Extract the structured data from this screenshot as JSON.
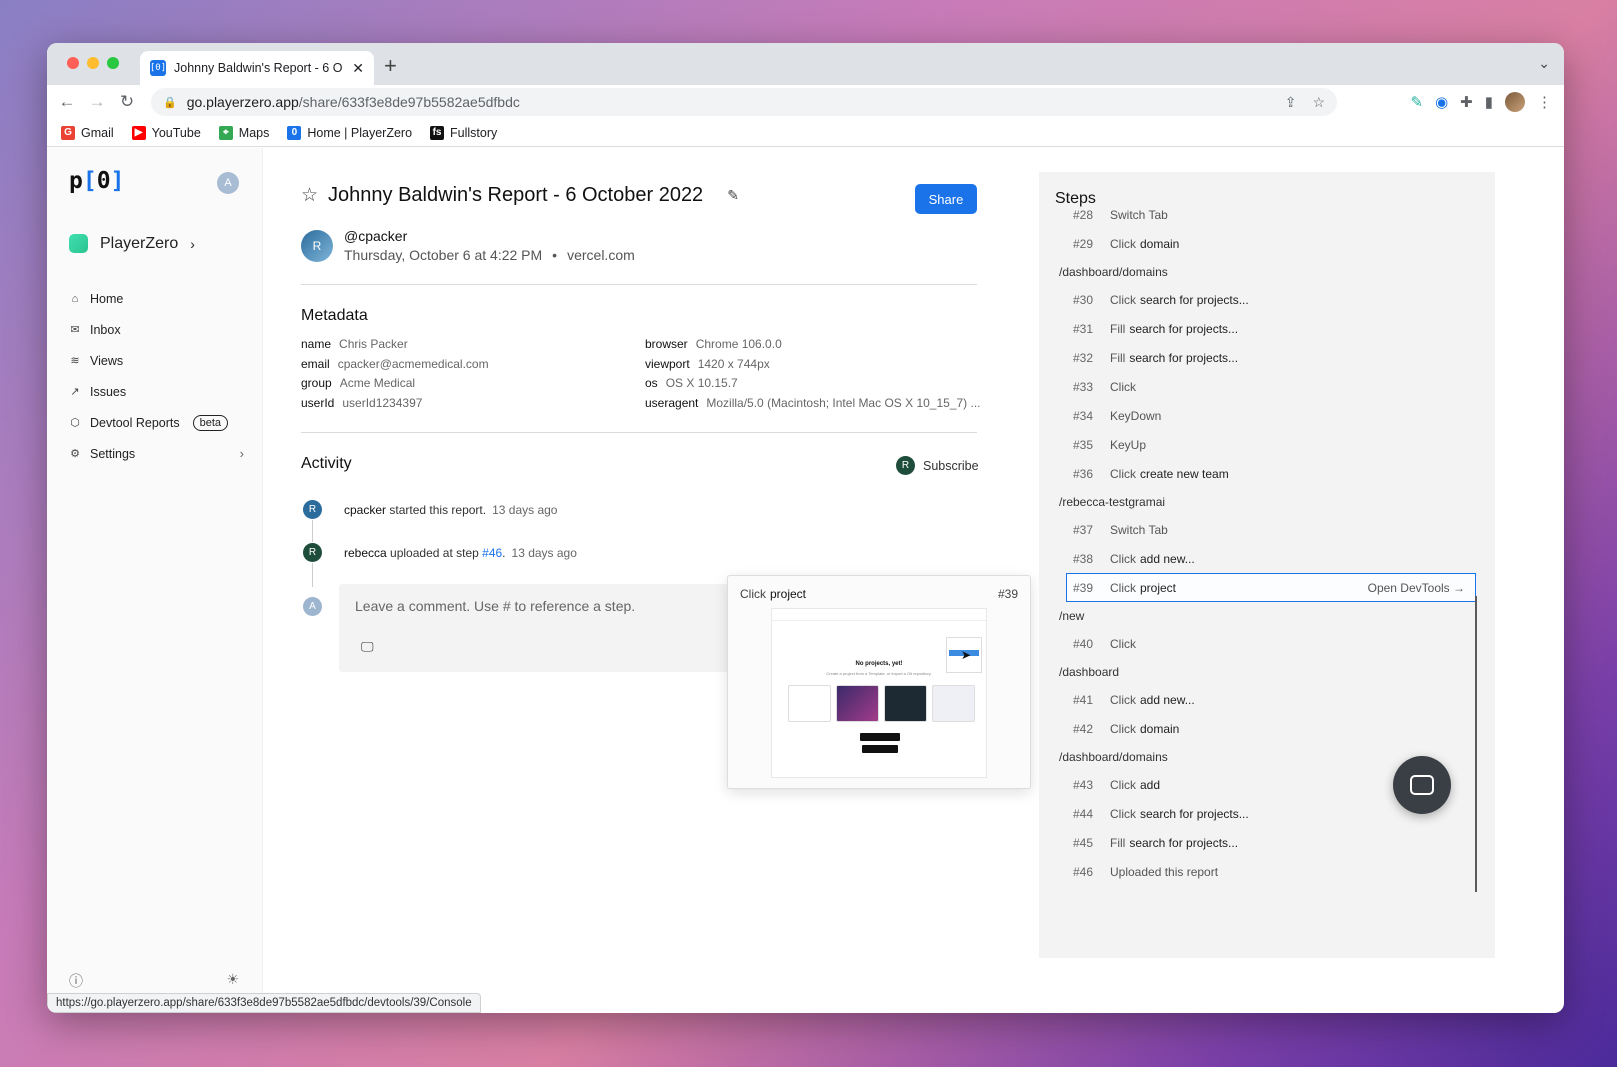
{
  "browser": {
    "tab_title": "Johnny Baldwin's Report - 6 O",
    "url_host": "go.playerzero.app",
    "url_path": "/share/633f3e8de97b5582ae5dfbdc",
    "favicon_text": "[0]",
    "bookmarks": [
      {
        "label": "Gmail",
        "icon": "gmail-icon",
        "color": "#ea4335"
      },
      {
        "label": "YouTube",
        "icon": "youtube-icon",
        "color": "#ff0000"
      },
      {
        "label": "Maps",
        "icon": "maps-icon",
        "color": "#34a853"
      },
      {
        "label": "Home | PlayerZero",
        "icon": "playerzero-icon",
        "color": "#1a73e8"
      },
      {
        "label": "Fullstory",
        "icon": "fullstory-icon",
        "color": "#111111"
      }
    ],
    "status_url": "https://go.playerzero.app/share/633f3e8de97b5582ae5dfbdc/devtools/39/Console"
  },
  "sidebar": {
    "logo_text": "p[0]",
    "user_initial": "A",
    "org_name": "PlayerZero",
    "nav": [
      {
        "label": "Home",
        "icon": "home-icon"
      },
      {
        "label": "Inbox",
        "icon": "inbox-icon"
      },
      {
        "label": "Views",
        "icon": "layers-icon"
      },
      {
        "label": "Issues",
        "icon": "arrow-up-right-icon"
      },
      {
        "label": "Devtool Reports",
        "icon": "cube-icon",
        "badge": "beta"
      },
      {
        "label": "Settings",
        "icon": "gear-icon"
      }
    ]
  },
  "report": {
    "title": "Johnny Baldwin's Report - 6 October 2022",
    "share_label": "Share",
    "author_initial": "R",
    "handle": "@cpacker",
    "datetime": "Thursday, October 6 at 4:22 PM",
    "domain": "vercel.com",
    "metadata_title": "Metadata",
    "metadata_left": [
      {
        "k": "name",
        "v": "Chris Packer"
      },
      {
        "k": "email",
        "v": "cpacker@acmemedical.com"
      },
      {
        "k": "group",
        "v": "Acme Medical"
      },
      {
        "k": "userId",
        "v": "userId1234397"
      }
    ],
    "metadata_right": [
      {
        "k": "browser",
        "v": "Chrome 106.0.0"
      },
      {
        "k": "viewport",
        "v": "1420 x 744px"
      },
      {
        "k": "os",
        "v": "OS X 10.15.7"
      },
      {
        "k": "useragent",
        "v": "Mozilla/5.0 (Macintosh; Intel Mac OS X 10_15_7) ..."
      }
    ],
    "activity_title": "Activity",
    "subscribe_label": "Subscribe",
    "subscribe_initial": "R",
    "activity": [
      {
        "initial": "R",
        "who": "cpacker",
        "text": "started this report.",
        "ref": "",
        "when": "13 days ago",
        "color": "#2b6c9c"
      },
      {
        "initial": "R",
        "who": "rebecca",
        "text": "uploaded at step",
        "ref": "#46",
        "when": "13 days ago",
        "color": "#1f4d3c"
      }
    ],
    "comment_initial": "A",
    "comment_placeholder": "Leave a comment. Use # to reference a step."
  },
  "preview": {
    "verb": "Click",
    "target": "project",
    "num": "#39",
    "thumb_title": "No projects, yet!",
    "thumb_subtitle": "Create a project from a Template, or import a Git repository."
  },
  "steps": {
    "title": "Steps",
    "open_devtools": "Open DevTools",
    "items": [
      {
        "type": "step",
        "n": "#28",
        "verb": "Switch Tab",
        "tgt": ""
      },
      {
        "type": "step",
        "n": "#29",
        "verb": "Click",
        "tgt": "domain"
      },
      {
        "type": "route",
        "path": "/dashboard/domains"
      },
      {
        "type": "step",
        "n": "#30",
        "verb": "Click",
        "tgt": "search for projects..."
      },
      {
        "type": "step",
        "n": "#31",
        "verb": "Fill",
        "tgt": "search for projects..."
      },
      {
        "type": "step",
        "n": "#32",
        "verb": "Fill",
        "tgt": "search for projects..."
      },
      {
        "type": "step",
        "n": "#33",
        "verb": "Click",
        "tgt": ""
      },
      {
        "type": "step",
        "n": "#34",
        "verb": "KeyDown",
        "tgt": ""
      },
      {
        "type": "step",
        "n": "#35",
        "verb": "KeyUp",
        "tgt": ""
      },
      {
        "type": "step",
        "n": "#36",
        "verb": "Click",
        "tgt": "create new team"
      },
      {
        "type": "route",
        "path": "/rebecca-testgramai"
      },
      {
        "type": "step",
        "n": "#37",
        "verb": "Switch Tab",
        "tgt": ""
      },
      {
        "type": "step",
        "n": "#38",
        "verb": "Click",
        "tgt": "add new..."
      },
      {
        "type": "step",
        "n": "#39",
        "verb": "Click",
        "tgt": "project",
        "active": true
      },
      {
        "type": "route",
        "path": "/new"
      },
      {
        "type": "step",
        "n": "#40",
        "verb": "Click",
        "tgt": ""
      },
      {
        "type": "route",
        "path": "/dashboard"
      },
      {
        "type": "step",
        "n": "#41",
        "verb": "Click",
        "tgt": "add new..."
      },
      {
        "type": "step",
        "n": "#42",
        "verb": "Click",
        "tgt": "domain"
      },
      {
        "type": "route",
        "path": "/dashboard/domains"
      },
      {
        "type": "step",
        "n": "#43",
        "verb": "Click",
        "tgt": "add"
      },
      {
        "type": "step",
        "n": "#44",
        "verb": "Click",
        "tgt": "search for projects..."
      },
      {
        "type": "step",
        "n": "#45",
        "verb": "Fill",
        "tgt": "search for projects..."
      },
      {
        "type": "step",
        "n": "#46",
        "verb": "Uploaded this report",
        "tgt": ""
      }
    ]
  },
  "colors": {
    "accent": "#1a73e8",
    "org": "#2bc38f"
  }
}
